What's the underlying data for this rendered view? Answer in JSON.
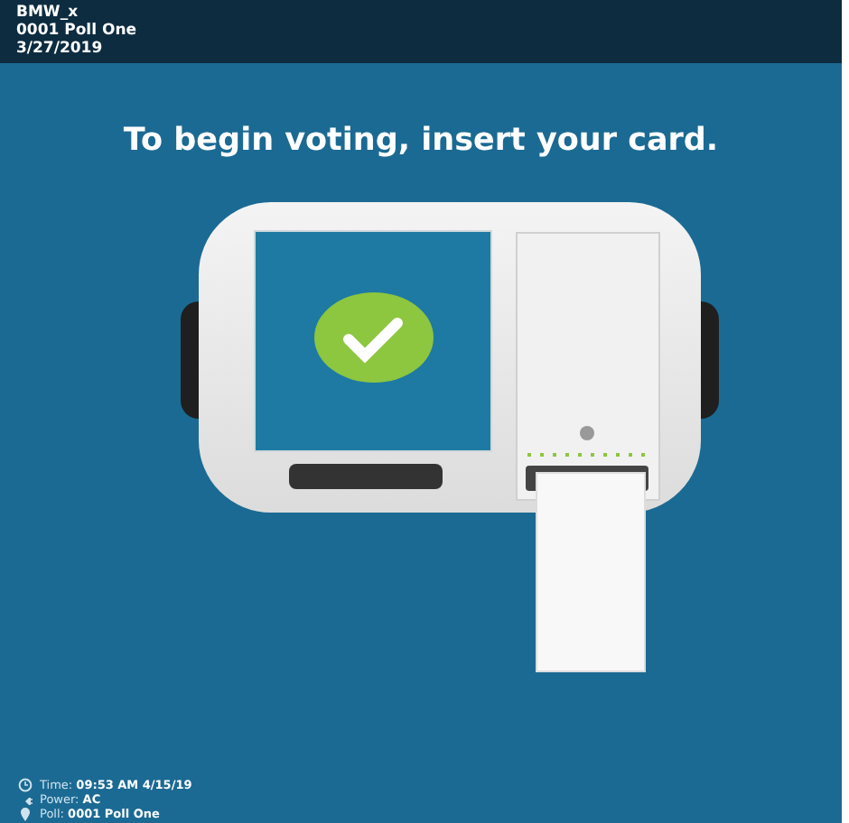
{
  "header": {
    "lines": [
      "BMW_x",
      "0001 Poll One",
      "3/27/2019"
    ]
  },
  "prompt": "To begin voting, insert your card.",
  "status": [
    {
      "kind": "time",
      "text": "Time: **09:53 AM 4/15/19**"
    },
    {
      "kind": "power",
      "text": "Power: **AC**"
    },
    {
      "kind": "poll",
      "text": "Poll: **0001 Poll One**"
    }
  ]
}
